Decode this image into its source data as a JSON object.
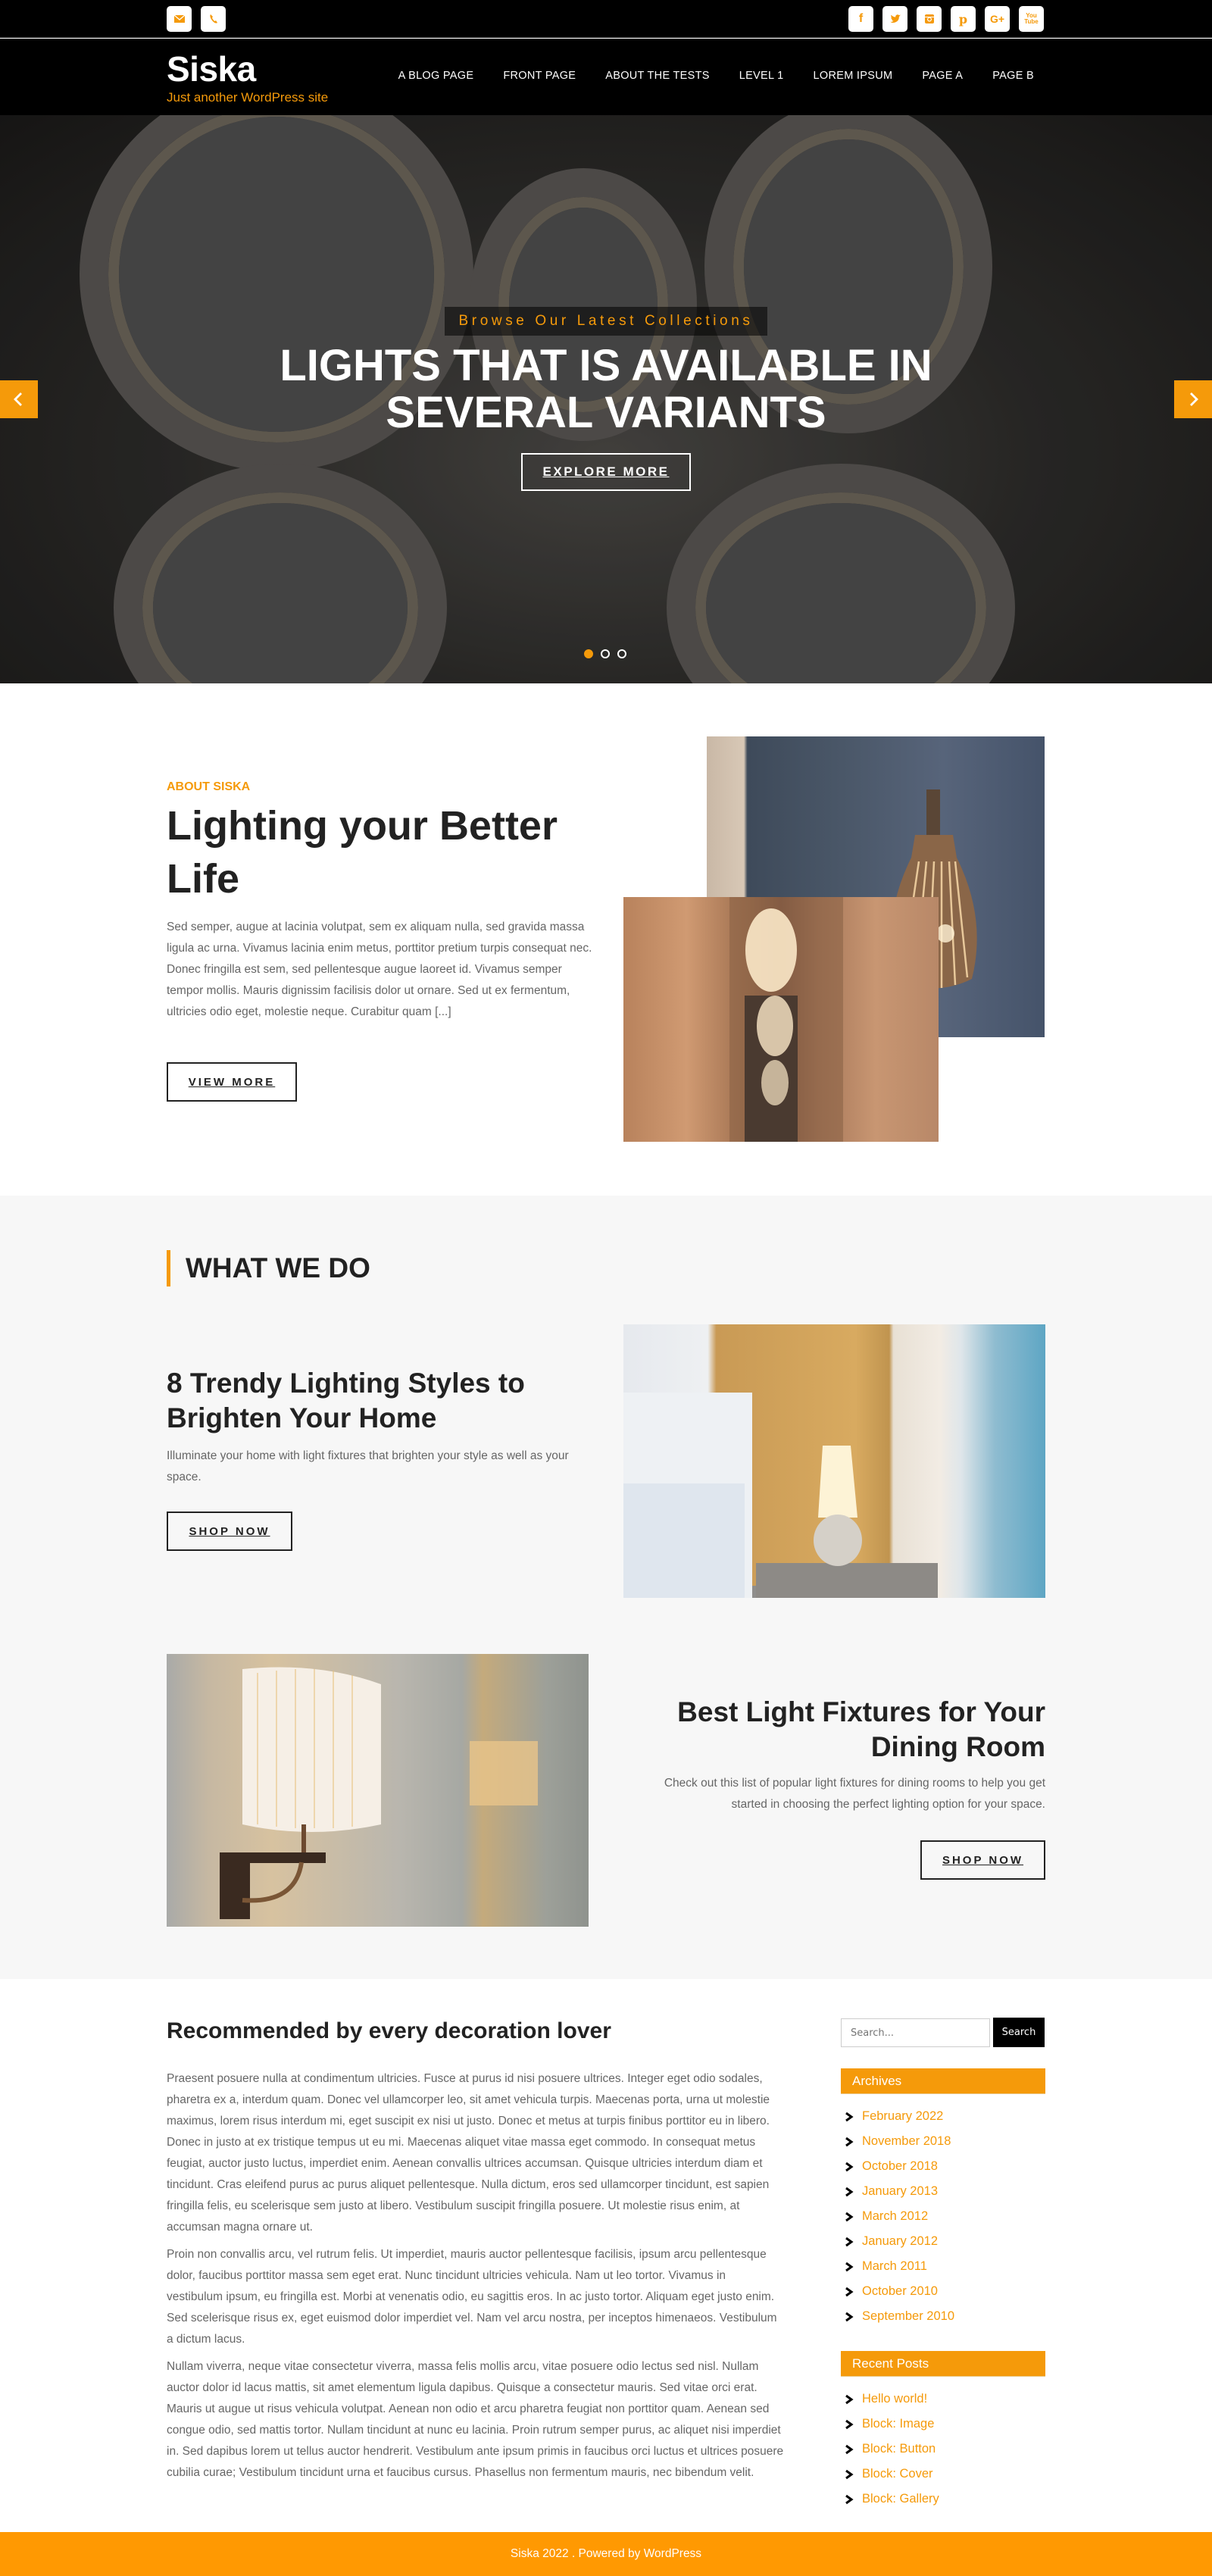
{
  "colors": {
    "accent": "#f59a0a",
    "dark": "#000000",
    "text": "#222222",
    "muted": "#666666",
    "section_bg": "#f7f7f7"
  },
  "topbar": {
    "contact_icons": [
      {
        "name": "email-icon"
      },
      {
        "name": "phone-icon"
      }
    ],
    "social_icons": [
      {
        "name": "facebook-icon",
        "glyph": "f"
      },
      {
        "name": "twitter-icon",
        "glyph": "t"
      },
      {
        "name": "instagram-icon",
        "glyph": "ig"
      },
      {
        "name": "pinterest-icon",
        "glyph": "p"
      },
      {
        "name": "google-plus-icon",
        "glyph": "G+"
      },
      {
        "name": "youtube-icon",
        "glyph": "You Tube"
      }
    ]
  },
  "header": {
    "site_title": "Siska",
    "tagline": "Just another WordPress site",
    "nav": [
      "A BLOG PAGE",
      "FRONT PAGE",
      "ABOUT THE TESTS",
      "LEVEL 1",
      "LOREM IPSUM",
      "PAGE A",
      "PAGE B"
    ]
  },
  "hero": {
    "eyebrow": "Browse Our Latest Collections",
    "title": "LIGHTS THAT IS AVAILABLE IN SEVERAL VARIANTS",
    "button": "EXPLORE MORE",
    "slide_count": 3,
    "active_slide": 1
  },
  "about": {
    "eyebrow": "ABOUT SISKA",
    "title": "Lighting your Better Life",
    "text": "Sed semper, augue at lacinia volutpat, sem ex aliquam nulla, sed gravida massa ligula ac urna. Vivamus lacinia enim metus, porttitor pretium turpis consequat nec. Donec fringilla est sem, sed pellentesque augue laoreet id. Vivamus semper tempor mollis. Mauris dignissim facilisis dolor ut ornare. Sed ut ex fermentum, ultricies odio eget, molestie neque. Curabitur quam [...]",
    "button": "VIEW MORE"
  },
  "what_we_do": {
    "title": "WHAT WE DO",
    "cards": [
      {
        "title": "8 Trendy Lighting Styles to Brighten Your Home",
        "text": "Illuminate your home with light fixtures that brighten your style as well as your space.",
        "button": "SHOP NOW"
      },
      {
        "title": "Best Light Fixtures for Your Dining Room",
        "text": "Check out this list of popular light fixtures for dining rooms to help you get started in choosing the perfect lighting option for your space.",
        "button": "SHOP NOW"
      }
    ]
  },
  "recommended": {
    "title": "Recommended by every decoration lover",
    "paragraphs": [
      "Praesent posuere nulla at condimentum ultricies. Fusce at purus id nisi posuere ultrices. Integer eget odio sodales, pharetra ex a, interdum quam. Donec vel ullamcorper leo, sit amet vehicula turpis. Maecenas porta, urna ut molestie maximus, lorem risus interdum mi, eget suscipit ex nisi ut justo. Donec et metus at turpis finibus porttitor eu in libero. Donec in justo at ex tristique tempus ut eu mi. Maecenas aliquet vitae massa eget commodo. In consequat metus feugiat, auctor justo luctus, imperdiet enim. Aenean convallis ultrices accumsan. Quisque ultricies interdum diam et tincidunt. Cras eleifend purus ac purus aliquet pellentesque. Nulla dictum, eros sed ullamcorper tincidunt, est sapien fringilla felis, eu scelerisque sem justo at libero. Vestibulum suscipit fringilla posuere. Ut molestie risus enim, at accumsan magna ornare ut.",
      "Proin non convallis arcu, vel rutrum felis. Ut imperdiet, mauris auctor pellentesque facilisis, ipsum arcu pellentesque dolor, faucibus porttitor massa sem eget erat. Nunc tincidunt ultricies vehicula. Nam ut leo tortor. Vivamus in vestibulum ipsum, eu fringilla est. Morbi at venenatis odio, eu sagittis eros. In ac justo tortor. Aliquam eget justo enim. Sed scelerisque risus ex, eget euismod dolor imperdiet vel. Nam vel arcu nostra, per inceptos himenaeos. Vestibulum a dictum lacus.",
      "Nullam viverra, neque vitae consectetur viverra, massa felis mollis arcu, vitae posuere odio lectus sed nisl. Nullam auctor dolor id lacus mattis, sit amet elementum ligula dapibus. Quisque a consectetur mauris. Sed vitae orci erat. Mauris ut augue ut risus vehicula volutpat. Aenean non odio et arcu pharetra feugiat non porttitor quam. Aenean sed congue odio, sed mattis tortor. Nullam tincidunt at nunc eu lacinia. Proin rutrum semper purus, ac aliquet nisi imperdiet in. Sed dapibus lorem ut tellus auctor hendrerit. Vestibulum ante ipsum primis in faucibus orci luctus et ultrices posuere cubilia curae; Vestibulum tincidunt urna et faucibus cursus. Phasellus non fermentum mauris, nec bibendum velit."
    ]
  },
  "sidebar": {
    "search": {
      "placeholder": "Search...",
      "button": "Search"
    },
    "archives": {
      "title": "Archives",
      "items": [
        "February 2022",
        "November 2018",
        "October 2018",
        "January 2013",
        "March 2012",
        "January 2012",
        "March 2011",
        "October 2010",
        "September 2010"
      ]
    },
    "recent_posts": {
      "title": "Recent Posts",
      "items": [
        "Hello world!",
        "Block: Image",
        "Block: Button",
        "Block: Cover",
        "Block: Gallery"
      ]
    }
  },
  "footer": {
    "text": "Siska 2022 . Powered by WordPress"
  }
}
